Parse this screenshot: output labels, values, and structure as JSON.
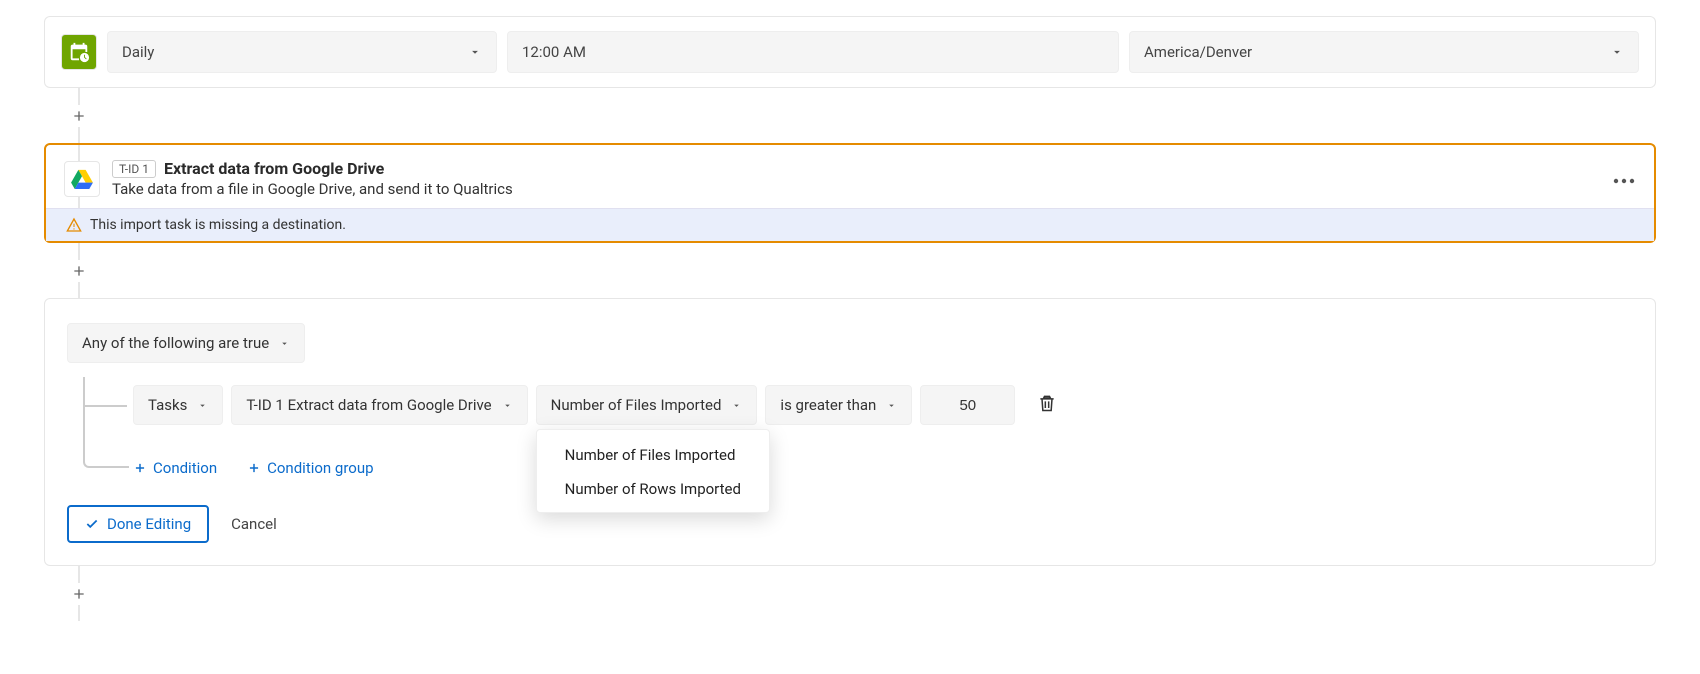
{
  "schedule": {
    "frequency": "Daily",
    "time": "12:00 AM",
    "timezone": "America/Denver"
  },
  "task": {
    "id_chip": "T-ID 1",
    "title": "Extract data from Google Drive",
    "description": "Take data from a file in Google Drive, and send it to Qualtrics",
    "warning": "This import task is missing a destination."
  },
  "condition": {
    "group_label": "Any of the following are true",
    "source_type": "Tasks",
    "task_ref": "T-ID 1 Extract data from Google Drive",
    "metric": "Number of Files Imported",
    "operator": "is greater than",
    "value": "50",
    "metric_options": [
      "Number of Files Imported",
      "Number of Rows Imported"
    ],
    "add_condition_label": "Condition",
    "add_group_label": "Condition group"
  },
  "footer": {
    "done": "Done Editing",
    "cancel": "Cancel"
  }
}
